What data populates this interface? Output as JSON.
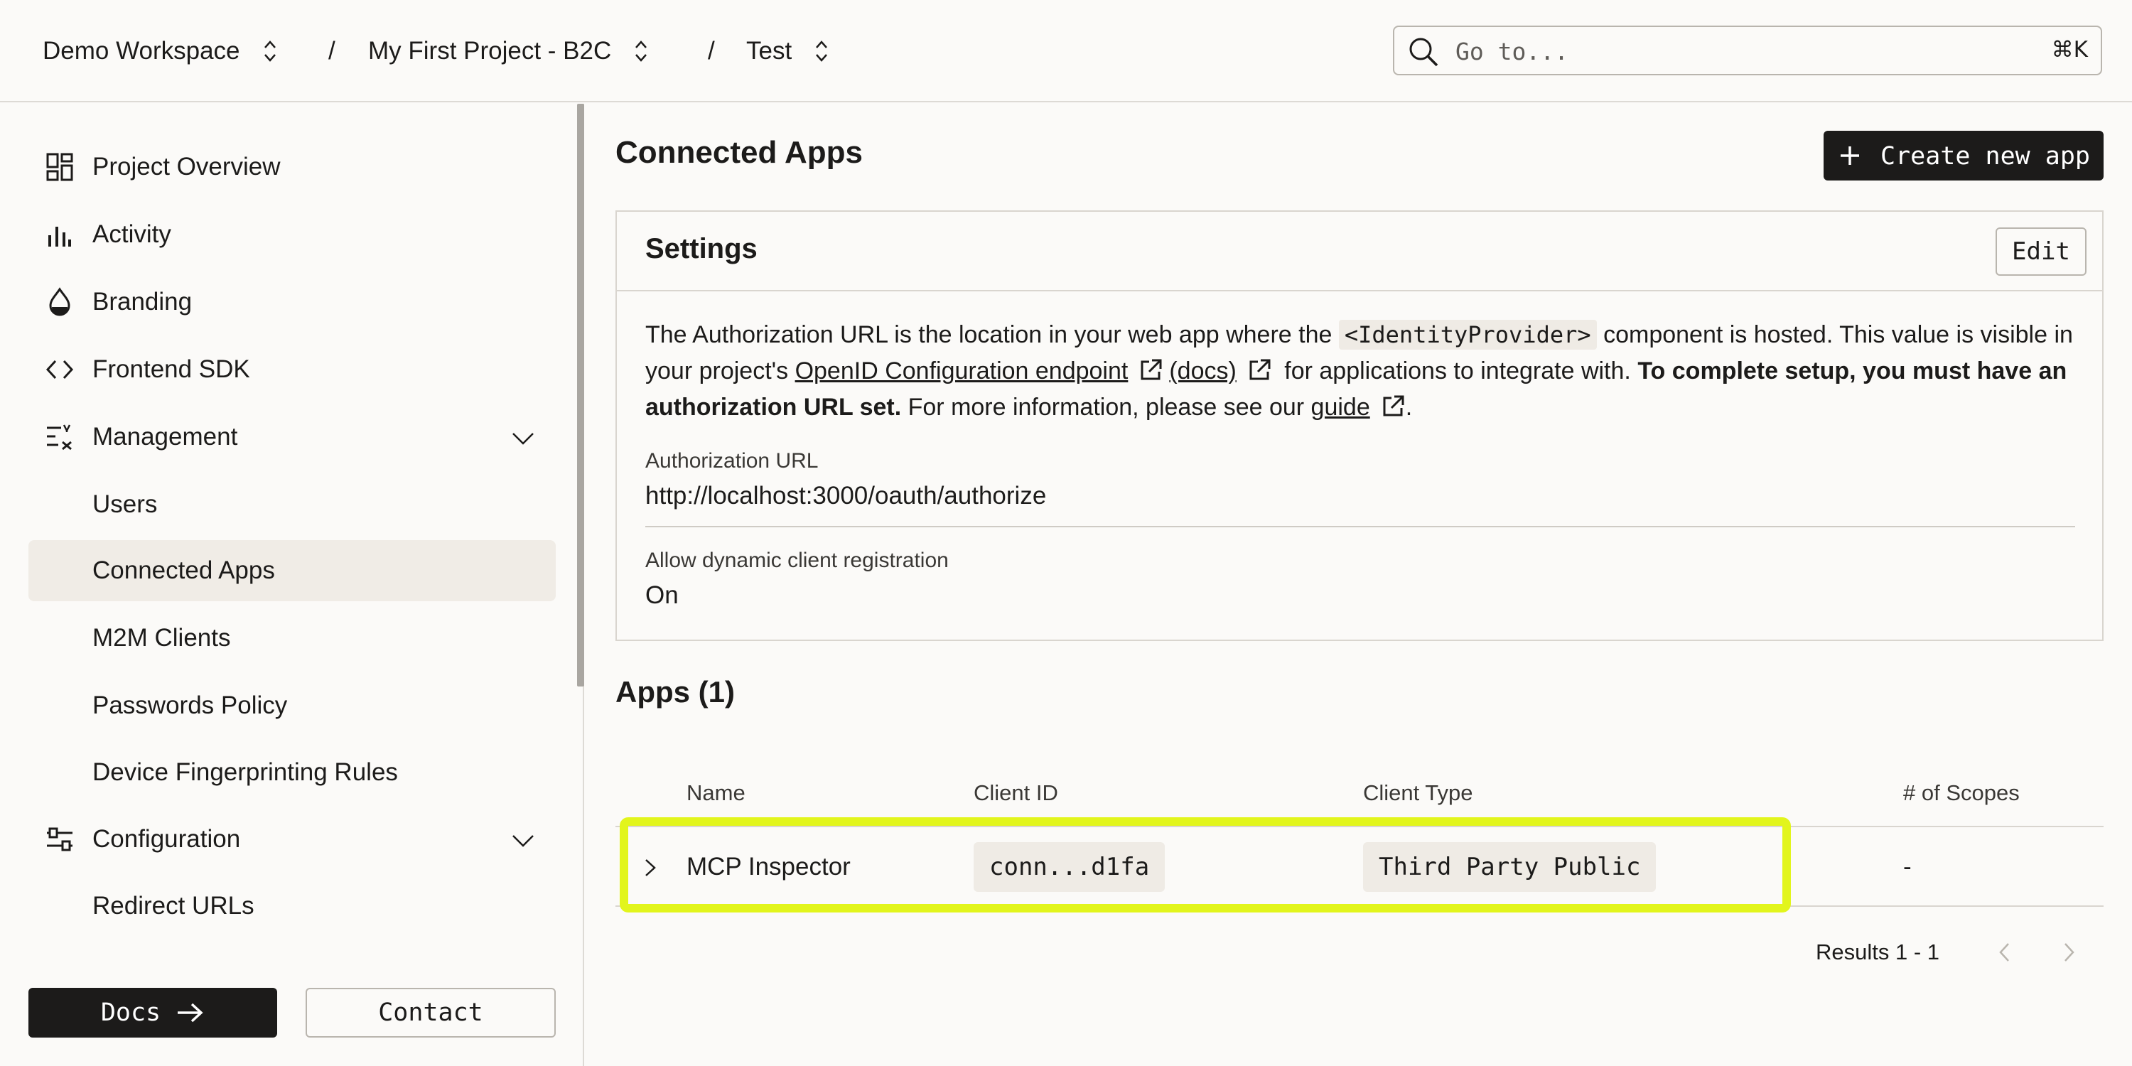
{
  "breadcrumb": {
    "workspace": "Demo Workspace",
    "project": "My First Project - B2C",
    "environment": "Test",
    "separator": "/"
  },
  "search": {
    "placeholder": "Go to...",
    "shortcut": "⌘K"
  },
  "sidebar": {
    "items": [
      {
        "label": "Project Overview",
        "icon": "dashboard-icon"
      },
      {
        "label": "Activity",
        "icon": "bar-chart-icon"
      },
      {
        "label": "Branding",
        "icon": "paint-drop-icon"
      },
      {
        "label": "Frontend SDK",
        "icon": "code-icon"
      },
      {
        "label": "Management",
        "icon": "management-icon",
        "expanded": true
      },
      {
        "label": "Users"
      },
      {
        "label": "Connected Apps",
        "active": true
      },
      {
        "label": "M2M Clients"
      },
      {
        "label": "Passwords Policy"
      },
      {
        "label": "Device Fingerprinting Rules"
      },
      {
        "label": "Configuration",
        "icon": "sliders-icon",
        "expanded": true
      },
      {
        "label": "Redirect URLs"
      }
    ],
    "docs_label": "Docs",
    "contact_label": "Contact"
  },
  "main": {
    "title": "Connected Apps",
    "create_label": "Create new app",
    "settings": {
      "title": "Settings",
      "edit_label": "Edit",
      "desc_part1": "The Authorization URL is the location in your web app where the ",
      "desc_code": "<IdentityProvider>",
      "desc_part2": " component is hosted. This value is visible in your project's ",
      "desc_link1": "OpenID Configuration endpoint",
      "desc_link2": "(docs)",
      "desc_part3": " for applications to integrate with. ",
      "desc_bold": "To complete setup, you must have an authorization URL set.",
      "desc_part4": " For more information, please see our ",
      "desc_link3": "guide",
      "desc_end": ".",
      "auth_url_label": "Authorization URL",
      "auth_url_value": "http://localhost:3000/oauth/authorize",
      "dcr_label": "Allow dynamic client registration",
      "dcr_value": "On"
    },
    "apps": {
      "title": "Apps (1)",
      "columns": [
        "Name",
        "Client ID",
        "Client Type",
        "# of Scopes"
      ],
      "rows": [
        {
          "name": "MCP Inspector",
          "client_id": "conn...d1fa",
          "client_type": "Third Party Public",
          "scopes": "-"
        }
      ],
      "results": "Results 1 - 1"
    }
  },
  "colors": {
    "accent_dark": "#1c1b1a",
    "highlight": "#e2f51c",
    "background": "#fbfaf8"
  }
}
